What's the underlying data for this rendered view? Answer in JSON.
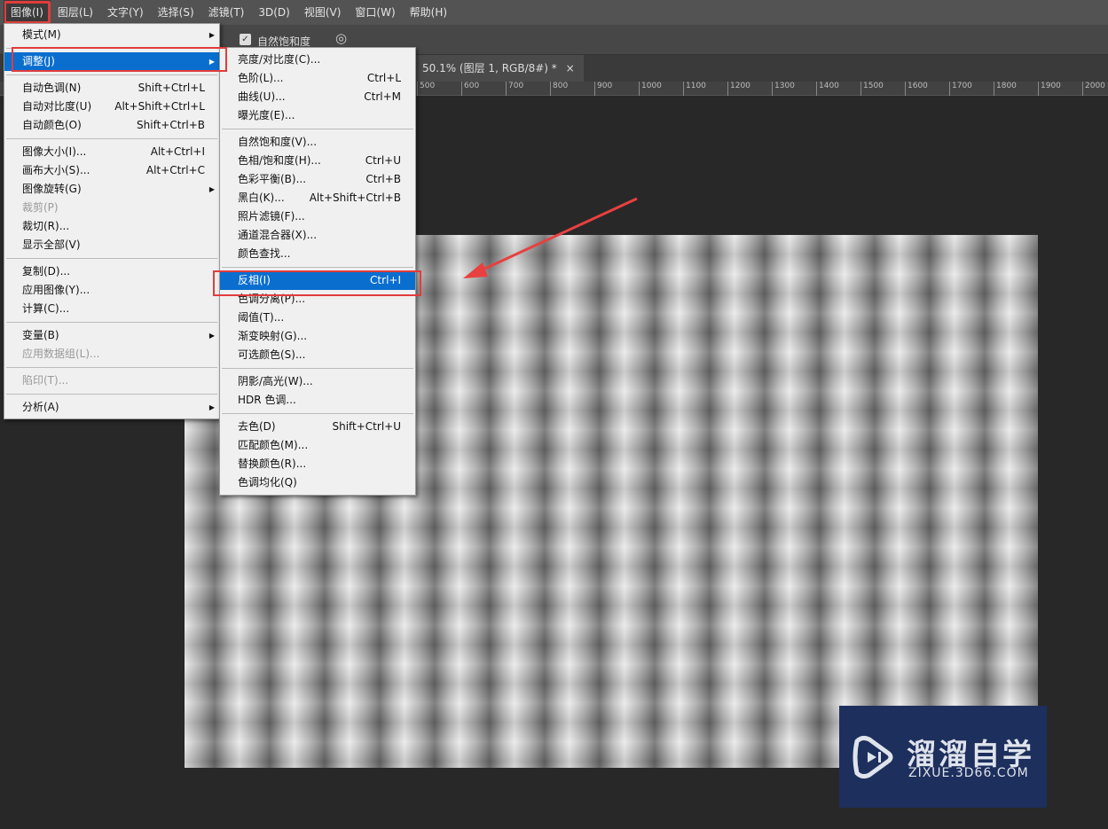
{
  "menubar": [
    "图像(I)",
    "图层(L)",
    "文字(Y)",
    "选择(S)",
    "滤镜(T)",
    "3D(D)",
    "视图(V)",
    "窗口(W)",
    "帮助(H)"
  ],
  "options": {
    "vibrance_checkbox": "自然饱和度"
  },
  "doc_tab": {
    "title": "50.1% (图层 1, RGB/8#) *",
    "close": "×"
  },
  "ruler": [
    "500",
    "600",
    "700",
    "800",
    "900",
    "1000",
    "1100",
    "1200",
    "1300",
    "1400",
    "1500",
    "1600",
    "1700",
    "1800",
    "1900",
    "2000"
  ],
  "image_menu": [
    {
      "label": "模式(M)",
      "sub": true
    },
    "-",
    {
      "label": "调整(J)",
      "sub": true,
      "hl": true
    },
    "-",
    {
      "label": "自动色调(N)",
      "sc": "Shift+Ctrl+L"
    },
    {
      "label": "自动对比度(U)",
      "sc": "Alt+Shift+Ctrl+L"
    },
    {
      "label": "自动颜色(O)",
      "sc": "Shift+Ctrl+B"
    },
    "-",
    {
      "label": "图像大小(I)...",
      "sc": "Alt+Ctrl+I"
    },
    {
      "label": "画布大小(S)...",
      "sc": "Alt+Ctrl+C"
    },
    {
      "label": "图像旋转(G)",
      "sub": true
    },
    {
      "label": "裁剪(P)",
      "dis": true
    },
    {
      "label": "裁切(R)..."
    },
    {
      "label": "显示全部(V)"
    },
    "-",
    {
      "label": "复制(D)..."
    },
    {
      "label": "应用图像(Y)..."
    },
    {
      "label": "计算(C)..."
    },
    "-",
    {
      "label": "变量(B)",
      "sub": true
    },
    {
      "label": "应用数据组(L)...",
      "dis": true
    },
    "-",
    {
      "label": "陷印(T)...",
      "dis": true
    },
    "-",
    {
      "label": "分析(A)",
      "sub": true
    }
  ],
  "adjust_menu": [
    {
      "label": "亮度/对比度(C)..."
    },
    {
      "label": "色阶(L)...",
      "sc": "Ctrl+L"
    },
    {
      "label": "曲线(U)...",
      "sc": "Ctrl+M"
    },
    {
      "label": "曝光度(E)..."
    },
    "-",
    {
      "label": "自然饱和度(V)..."
    },
    {
      "label": "色相/饱和度(H)...",
      "sc": "Ctrl+U"
    },
    {
      "label": "色彩平衡(B)...",
      "sc": "Ctrl+B"
    },
    {
      "label": "黑白(K)...",
      "sc": "Alt+Shift+Ctrl+B"
    },
    {
      "label": "照片滤镜(F)..."
    },
    {
      "label": "通道混合器(X)..."
    },
    {
      "label": "颜色查找..."
    },
    "-",
    {
      "label": "反相(I)",
      "sc": "Ctrl+I",
      "hl": true
    },
    {
      "label": "色调分离(P)..."
    },
    {
      "label": "阈值(T)..."
    },
    {
      "label": "渐变映射(G)..."
    },
    {
      "label": "可选颜色(S)..."
    },
    "-",
    {
      "label": "阴影/高光(W)..."
    },
    {
      "label": "HDR 色调..."
    },
    "-",
    {
      "label": "去色(D)",
      "sc": "Shift+Ctrl+U"
    },
    {
      "label": "匹配颜色(M)..."
    },
    {
      "label": "替换颜色(R)..."
    },
    {
      "label": "色调均化(Q)"
    }
  ],
  "watermark": {
    "name": "溜溜自学",
    "url": "ZIXUE.3D66.COM"
  }
}
